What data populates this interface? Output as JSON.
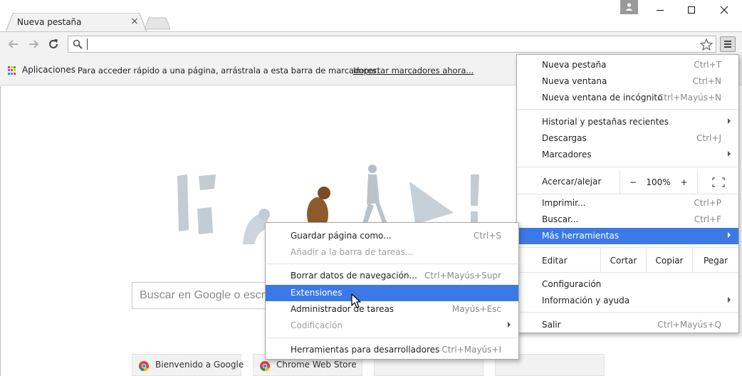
{
  "tab": {
    "title": "Nueva pestaña",
    "close_glyph": "×"
  },
  "window_controls": {
    "profile_icon": "person-icon",
    "minimize_icon": "minimize-icon",
    "maximize_icon": "maximize-icon",
    "close_icon": "close-icon"
  },
  "toolbar": {
    "back_icon": "arrow-left-icon",
    "forward_icon": "arrow-right-icon",
    "reload_icon": "reload-icon",
    "address_value": "",
    "search_icon": "magnifier-icon",
    "bookmark_icon": "star-icon",
    "menu_icon": "hamburger-icon"
  },
  "bookmarks_bar": {
    "apps_label": "Aplicaciones",
    "hint": "Para acceder rápido a una página, arrástrala a esta barra de marcadores.",
    "import_link": "Importar marcadores ahora..."
  },
  "new_tab_page": {
    "search_placeholder": "Buscar en Google o escr",
    "tiles": [
      {
        "title": "Bienvenido a Google",
        "icon": "chrome-icon"
      },
      {
        "title": "Chrome Web Store",
        "icon": "chrome-icon"
      },
      {
        "title": ""
      },
      {
        "title": ""
      }
    ]
  },
  "main_menu": {
    "new_tab": {
      "label": "Nueva pestaña",
      "shortcut": "Ctrl+T"
    },
    "new_window": {
      "label": "Nueva ventana",
      "shortcut": "Ctrl+N"
    },
    "incognito": {
      "label": "Nueva ventana de incógnito",
      "shortcut": "Ctrl+Mayús+N"
    },
    "history": {
      "label": "Historial y pestañas recientes"
    },
    "downloads": {
      "label": "Descargas",
      "shortcut": "Ctrl+J"
    },
    "bookmarks": {
      "label": "Marcadores"
    },
    "zoom": {
      "label": "Acercar/alejar",
      "minus": "−",
      "value": "100%",
      "plus": "+",
      "fullscreen_icon": "fullscreen-icon"
    },
    "print": {
      "label": "Imprimir...",
      "shortcut": "Ctrl+P"
    },
    "find": {
      "label": "Buscar...",
      "shortcut": "Ctrl+F"
    },
    "more_tools": {
      "label": "Más herramientas"
    },
    "edit": {
      "label": "Editar",
      "cut": "Cortar",
      "copy": "Copiar",
      "paste": "Pegar"
    },
    "settings": {
      "label": "Configuración"
    },
    "help": {
      "label": "Información y ayuda"
    },
    "exit": {
      "label": "Salir",
      "shortcut": "Ctrl+Mayús+Q"
    }
  },
  "sub_menu": {
    "save_page": {
      "label": "Guardar página como...",
      "shortcut": "Ctrl+S"
    },
    "add_taskbar": {
      "label": "Añadir a la barra de tareas..."
    },
    "clear_data": {
      "label": "Borrar datos de navegación...",
      "shortcut": "Ctrl+Mayús+Supr"
    },
    "extensions": {
      "label": "Extensiones"
    },
    "task_manager": {
      "label": "Administrador de tareas",
      "shortcut": "Mayús+Esc"
    },
    "encoding": {
      "label": "Codificación"
    },
    "dev_tools": {
      "label": "Herramientas para desarrolladores",
      "shortcut": "Ctrl+Mayús+I"
    }
  },
  "colors": {
    "highlight": "#3b7ae6",
    "toolbar_bg": "#f2f2f2",
    "disabled_text": "#a0a0a0"
  }
}
